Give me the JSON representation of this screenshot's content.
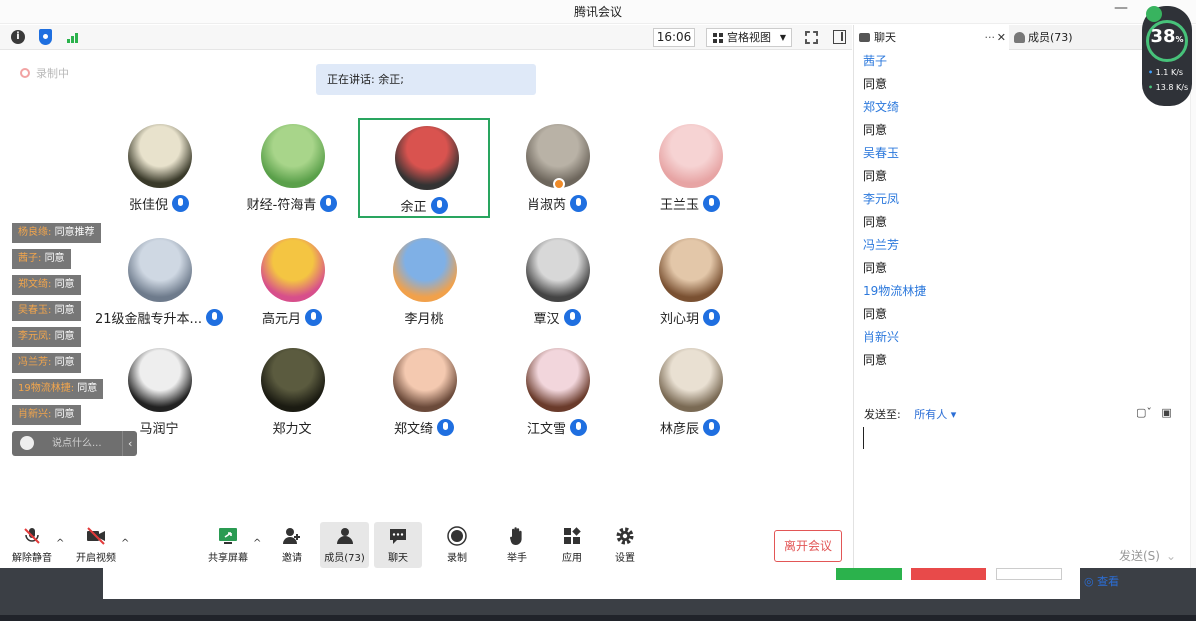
{
  "window": {
    "title": "腾讯会议",
    "minimize": "—"
  },
  "topbar": {
    "time": "16:06",
    "view_mode": "宫格视图"
  },
  "recording": {
    "label": "录制中"
  },
  "speaking": {
    "label": "正在讲话: 余正;"
  },
  "participants": [
    {
      "name": "张佳倪",
      "mic": true
    },
    {
      "name": "财经-符海青",
      "mic": true
    },
    {
      "name": "余正",
      "mic": true,
      "active": true
    },
    {
      "name": "肖淑芮",
      "mic": true
    },
    {
      "name": "王兰玉",
      "mic": true
    },
    {
      "name": "21级金融专升本...",
      "mic": true
    },
    {
      "name": "高元月",
      "mic": true
    },
    {
      "name": "李月桃",
      "mic": false
    },
    {
      "name": "覃汉",
      "mic": true
    },
    {
      "name": "刘心玥",
      "mic": true
    },
    {
      "name": "马润宁",
      "mic": false
    },
    {
      "name": "郑力文",
      "mic": false
    },
    {
      "name": "郑文绮",
      "mic": true
    },
    {
      "name": "江文雪",
      "mic": true
    },
    {
      "name": "林彦辰",
      "mic": true
    }
  ],
  "danmaku": [
    {
      "who": "杨良缘:",
      "text": "同意推荐"
    },
    {
      "who": "茜子:",
      "text": "同意"
    },
    {
      "who": "郑文绮:",
      "text": "同意"
    },
    {
      "who": "吴春玉:",
      "text": "同意"
    },
    {
      "who": "李元凤:",
      "text": "同意"
    },
    {
      "who": "冯兰芳:",
      "text": "同意"
    },
    {
      "who": "19物流林捷:",
      "text": "同意"
    },
    {
      "who": "肖新兴:",
      "text": "同意"
    }
  ],
  "chat_input_mini": {
    "placeholder": "说点什么..."
  },
  "toolbar": {
    "mute": "解除静音",
    "video": "开启视频",
    "share": "共享屏幕",
    "invite": "邀请",
    "members": "成员(73)",
    "chat": "聊天",
    "record": "录制",
    "raise_hand": "举手",
    "apps": "应用",
    "settings": "设置",
    "leave": "离开会议"
  },
  "panel": {
    "tab_chat": "聊天",
    "tab_more": "···",
    "tab_close": "✕",
    "tab_members": "成员(73)",
    "messages": [
      {
        "sender": "茜子",
        "text": "同意"
      },
      {
        "sender": "郑文绮",
        "text": "同意"
      },
      {
        "sender": "吴春玉",
        "text": "同意"
      },
      {
        "sender": "李元凤",
        "text": "同意"
      },
      {
        "sender": "冯兰芳",
        "text": "同意"
      },
      {
        "sender": "19物流林捷",
        "text": "同意"
      },
      {
        "sender": "肖新兴",
        "text": "同意"
      }
    ],
    "send_to_label": "发送至:",
    "send_to_value": "所有人",
    "send_button": "发送(S)"
  },
  "network": {
    "score": "38",
    "unit": "%",
    "up": "1.1",
    "down": "13.8",
    "rate_unit": "K/s"
  },
  "background_window": {
    "view_link": "查看"
  },
  "colors": {
    "accent": "#1f6fe0",
    "active_border": "#29a55f",
    "leave": "#e25656",
    "chat_sender": "#2b78dc"
  }
}
